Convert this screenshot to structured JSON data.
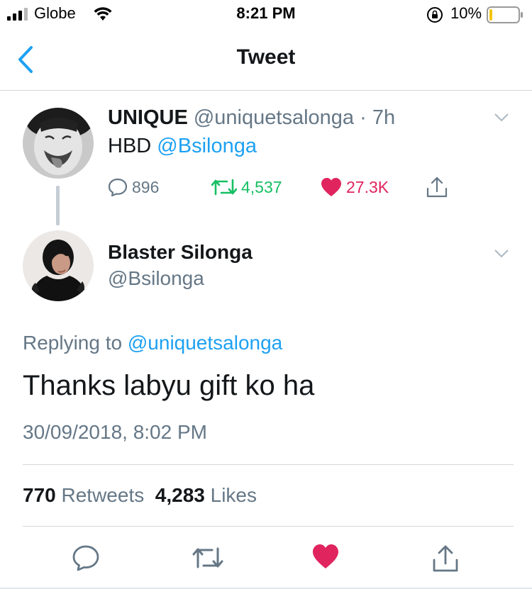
{
  "status_bar": {
    "carrier": "Globe",
    "time": "8:21 PM",
    "battery_percent": "10%",
    "battery_level": 0.1,
    "icons": [
      "signal-bars-icon",
      "wifi-icon",
      "orientation-lock-icon",
      "battery-icon"
    ]
  },
  "nav": {
    "back_icon": "chevron-left-icon",
    "title": "Tweet"
  },
  "parent_tweet": {
    "name": "UNIQUE",
    "handle": "@uniquetsalonga",
    "separator": "·",
    "age": "7h",
    "text_prefix": "HBD",
    "mention": "@Bsilonga",
    "reply_count": "896",
    "retweet_count": "4,537",
    "like_count": "27.3K",
    "liked": true
  },
  "main_tweet": {
    "name": "Blaster Silonga",
    "handle": "@Bsilonga",
    "replying_label": "Replying to",
    "replying_to": "@uniquetsalonga",
    "text": "Thanks labyu gift ko ha",
    "timestamp": "30/09/2018, 8:02 PM",
    "retweets_count": "770",
    "retweets_label": "Retweets",
    "likes_count": "4,283",
    "likes_label": "Likes",
    "liked": true
  },
  "colors": {
    "accent": "#1da1f2",
    "retweet_green": "#17bf63",
    "like_red": "#e0245e",
    "secondary_text": "#657786"
  }
}
